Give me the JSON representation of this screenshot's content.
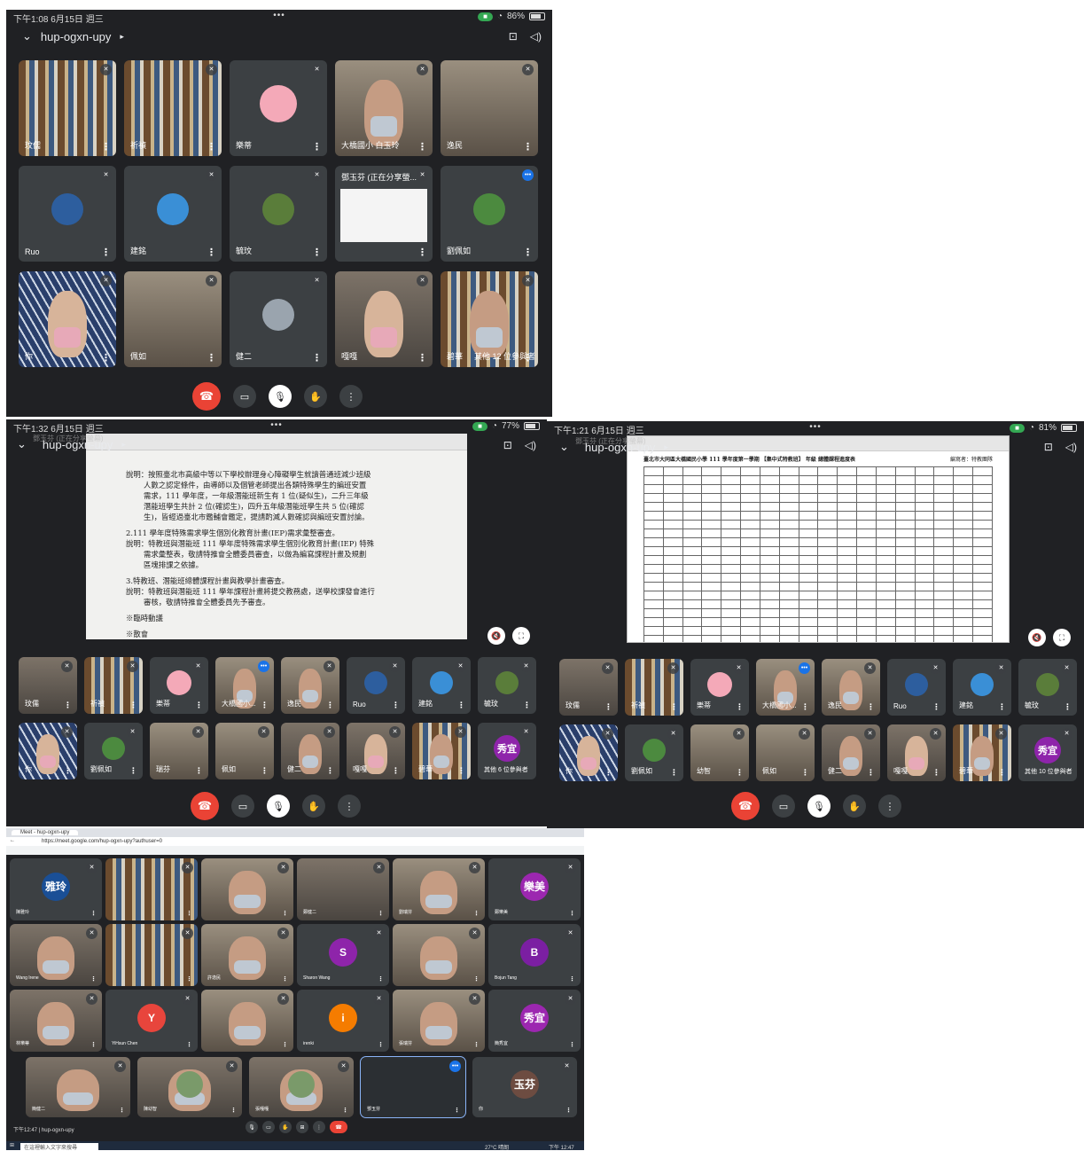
{
  "panel1": {
    "status": {
      "time": "下午1:08  6月15日 週三",
      "dots": "•••",
      "battery": "86%"
    },
    "meeting_code": "hup-ogxn-upy",
    "tiles": [
      {
        "name": "玟儒"
      },
      {
        "name": "祈禎"
      },
      {
        "name": "樂蒂"
      },
      {
        "name": "大橋國小 白玉玲"
      },
      {
        "name": "逸民"
      },
      {
        "name": "Ruo"
      },
      {
        "name": "建銘"
      },
      {
        "name": "毓玟"
      },
      {
        "name": "鄧玉芬 (正在分享螢..."
      },
      {
        "name": "劉佩如"
      },
      {
        "name": "你"
      },
      {
        "name": "佩如"
      },
      {
        "name": "健二"
      },
      {
        "name": "嘎嘎"
      },
      {
        "name": "碧華"
      }
    ],
    "others_label": "其他 12 位參與者"
  },
  "panel2": {
    "status": {
      "time": "下午1:32  6月15日 週三",
      "dots": "•••",
      "battery": "77%"
    },
    "meeting_code": "hup-ogxn-upy",
    "presenter_label": "鄧玉芬 (正在分享螢幕)",
    "doc_lines": [
      "說明：按照臺北市高級中等以下學校辦理身心障礙學生就讀普通班減少班級",
      "人數之認定條件，由導師以及個管老師提出各類特殊學生的編班安置",
      "需求，111 學年度，一年級潛能班新生有 1 位(疑似生)，二升三年級",
      "潛能班學生共計 2 位(確認生)，四升五年級潛能班學生共 5 位(確認",
      "生)，皆經過臺北市鑑輔會鑑定，提請酌減人數確認與編班安置討論。",
      "2.111 學年度特殊需求學生個別化教育計畫(IEP)需求彙整審查。",
      "說明：特教班與潛能班 111 學年度特殊需求學生個別化教育計畫(IEP) 特殊",
      "需求彙整表，敬請特推會全體委員審查，以做為編寫課程計畫及規劃",
      "區塊排課之依據。",
      "3.特教班、潛能班總體課程計畫與教學計畫審查。",
      "說明：特教班與潛能班 111 學年課程計畫將提交教務處，送學校課發會進行",
      "審核，敬請特推會全體委員先予審查。",
      "※臨時動議",
      "※散會"
    ],
    "tiles_row1": [
      {
        "name": "玟儒"
      },
      {
        "name": "祈禎"
      },
      {
        "name": "樂蒂"
      },
      {
        "name": "大橋國小..."
      },
      {
        "name": "逸民"
      },
      {
        "name": "Ruo"
      },
      {
        "name": "建銘"
      },
      {
        "name": "毓玟"
      }
    ],
    "tiles_row2": [
      {
        "name": "你"
      },
      {
        "name": "劉佩如"
      },
      {
        "name": "瑞芬"
      },
      {
        "name": "佩如"
      },
      {
        "name": "健二"
      },
      {
        "name": "嘎嘎"
      },
      {
        "name": "碧華"
      }
    ],
    "others_avatar": "秀宜",
    "others_label": "其他 6 位參與者"
  },
  "panel3": {
    "status": {
      "time": "下午1:21  6月15日 週三",
      "dots": "•••",
      "battery": "81%"
    },
    "meeting_code": "hup-ogxn-upy",
    "presenter_label": "鄧玉芬 (正在分享螢幕)",
    "sheet_title": "臺北市大同區大橋國民小學 111 學年度第一學期 【集中式特教班】 年級 總體課程進度表",
    "sheet_author": "編寫者：特教團隊",
    "tiles_row1": [
      {
        "name": "玟儒"
      },
      {
        "name": "祈禎"
      },
      {
        "name": "樂蒂"
      },
      {
        "name": "大橋國小..."
      },
      {
        "name": "逸民"
      },
      {
        "name": "Ruo"
      },
      {
        "name": "建銘"
      },
      {
        "name": "毓玟"
      }
    ],
    "tiles_row2": [
      {
        "name": "你"
      },
      {
        "name": "劉佩如"
      },
      {
        "name": "幼智"
      },
      {
        "name": "佩如"
      },
      {
        "name": "健二"
      },
      {
        "name": "嘎嘎"
      },
      {
        "name": "碧華"
      }
    ],
    "others_avatar": "秀宜",
    "others_label": "其他 10 位參與者"
  },
  "panel4": {
    "tab_title": "Meet - hup-ogxn-upy",
    "url": "https://meet.google.com/hup-ogxn-upy?authuser=0",
    "grid": [
      [
        {
          "avatar": "雅玲",
          "name": "陳雅玲",
          "color": "#1a4f96"
        },
        {
          "name": ""
        },
        {
          "name": ""
        },
        {
          "name": "鄭健二"
        },
        {
          "name": "劉瑞芬"
        },
        {
          "avatar": "樂美",
          "name": "鄭樂美",
          "color": "#9c27b0"
        }
      ],
      [
        {
          "name": "Wang Irene"
        },
        {
          "name": ""
        },
        {
          "name": "許逸民"
        },
        {
          "avatar": "S",
          "name": "Sharon Wang",
          "color": "#8e24aa"
        },
        {
          "name": ""
        },
        {
          "avatar": "B",
          "name": "Bojun Tang",
          "color": "#7b1fa2"
        }
      ],
      [
        {
          "name": "林樂蒂"
        },
        {
          "avatar": "Y",
          "name": "YiHsun Chen",
          "color": "#e8453c"
        },
        {
          "name": ""
        },
        {
          "avatar": "i",
          "name": "irenki",
          "color": "#f57c00"
        },
        {
          "name": "張瑞芬"
        },
        {
          "avatar": "秀宜",
          "name": "簡秀宜",
          "color": "#9c27b0"
        }
      ]
    ],
    "bottom_row": [
      {
        "name": "簡健二"
      },
      {
        "name": "陳幼智"
      },
      {
        "name": "張嘎嘎"
      },
      {
        "name": "鄧玉芬"
      },
      {
        "avatar": "玉芬",
        "name": "你",
        "color": "#6d4c41"
      }
    ],
    "footer_time": "下午12:47",
    "footer_code": "hup-ogxn-upy",
    "search_placeholder": "在這裡輸入文字來搜尋",
    "tray_text": "27°C 晴朗",
    "clock": "下午 12:47"
  },
  "colors": {
    "meet_bg": "#202124",
    "tile_bg": "#3c4043",
    "end_call": "#ea4335",
    "accent": "#1a73e8"
  }
}
